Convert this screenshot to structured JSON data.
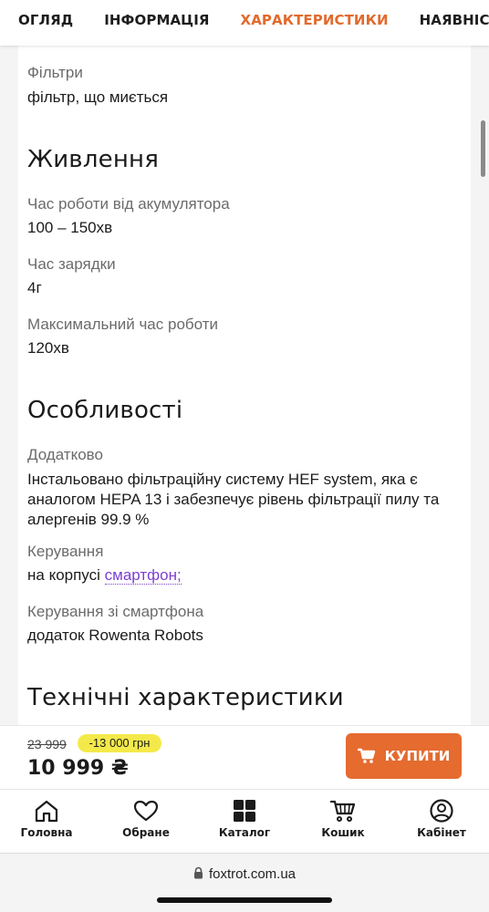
{
  "tabs": [
    {
      "label": "ОГЛЯД"
    },
    {
      "label": "ІНФОРМАЦІЯ"
    },
    {
      "label": "ХАРАКТЕРИСТИКИ",
      "active": true
    },
    {
      "label": "НАЯВНІСТЬ В МАГАЗИНАХ"
    }
  ],
  "specs": {
    "filters": {
      "label": "Фільтри",
      "value": "фільтр, що миється"
    },
    "power": {
      "title": "Живлення",
      "battery_time": {
        "label": "Час роботи від акумулятора",
        "value": "100 – 150хв"
      },
      "charge_time": {
        "label": "Час зарядки",
        "value": "4г"
      },
      "max_time": {
        "label": "Максимальний час роботи",
        "value": "120хв"
      }
    },
    "features": {
      "title": "Особливості",
      "extra": {
        "label": "Додатково",
        "value": "Інстальовано фільтраційну систему HEF system, яка є аналогом HEPA 13 і забезпечує рівень фільтрації пилу та алергенів 99.9 %"
      },
      "control": {
        "label": "Керування",
        "value_plain": "на корпусі",
        "value_link": "смартфон;"
      },
      "smartphone_control": {
        "label": "Керування зі смартфона",
        "value": "додаток Rowenta Robots"
      }
    },
    "technical": {
      "title": "Технічні характеристики"
    }
  },
  "buybar": {
    "old_price": "23 999",
    "discount": "-13 000 грн",
    "price": "10 999 ₴",
    "buy_label": "КУПИТИ",
    "accent_color": "#e56b2f"
  },
  "bottom_nav": [
    {
      "label": "Головна",
      "icon": "home-icon"
    },
    {
      "label": "Обране",
      "icon": "heart-icon"
    },
    {
      "label": "Каталог",
      "icon": "grid-icon"
    },
    {
      "label": "Кошик",
      "icon": "cart-icon"
    },
    {
      "label": "Кабінет",
      "icon": "user-icon"
    }
  ],
  "browser": {
    "url": "foxtrot.com.ua"
  }
}
